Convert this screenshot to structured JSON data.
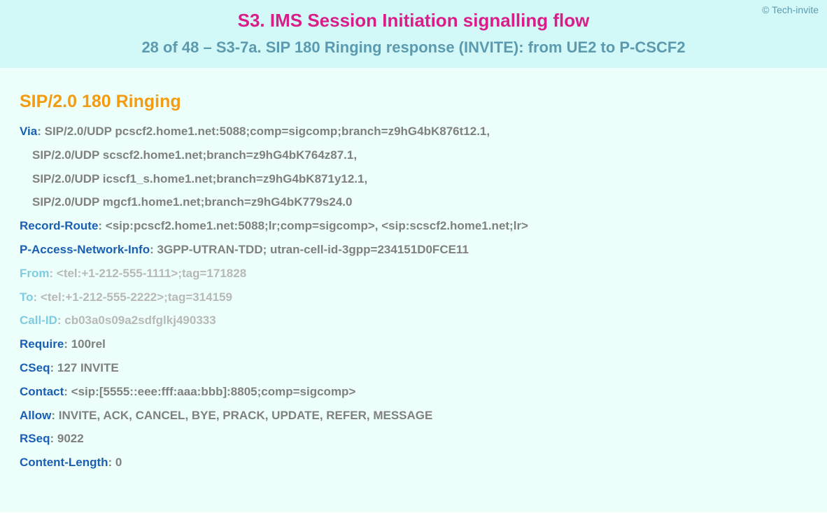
{
  "header": {
    "copyright": "© Tech-invite",
    "title": "S3. IMS Session Initiation signalling flow",
    "subtitle": "28 of 48 – S3-7a. SIP 180 Ringing response (INVITE): from UE2 to P-CSCF2"
  },
  "content": {
    "status_line": "SIP/2.0 180 Ringing",
    "headers": [
      {
        "name": "Via",
        "value": "SIP/2.0/UDP pcscf2.home1.net:5088;comp=sigcomp;branch=z9hG4bK876t12.1,",
        "faded": false,
        "continuations": [
          "SIP/2.0/UDP scscf2.home1.net;branch=z9hG4bK764z87.1,",
          "SIP/2.0/UDP icscf1_s.home1.net;branch=z9hG4bK871y12.1,",
          "SIP/2.0/UDP mgcf1.home1.net;branch=z9hG4bK779s24.0"
        ]
      },
      {
        "name": "Record-Route",
        "value": "<sip:pcscf2.home1.net:5088;lr;comp=sigcomp>, <sip:scscf2.home1.net;lr>",
        "faded": false
      },
      {
        "name": "P-Access-Network-Info",
        "value": "3GPP-UTRAN-TDD; utran-cell-id-3gpp=234151D0FCE11",
        "faded": false
      },
      {
        "name": "From",
        "value": "<tel:+1-212-555-1111>;tag=171828",
        "faded": true
      },
      {
        "name": "To",
        "value": "<tel:+1-212-555-2222>;tag=314159",
        "faded": true
      },
      {
        "name": "Call-ID",
        "value": "cb03a0s09a2sdfglkj490333",
        "faded": true
      },
      {
        "name": "Require",
        "value": "100rel",
        "faded": false
      },
      {
        "name": "CSeq",
        "value": "127 INVITE",
        "faded": false
      },
      {
        "name": "Contact",
        "value": "<sip:[5555::eee:fff:aaa:bbb]:8805;comp=sigcomp>",
        "faded": false
      },
      {
        "name": "Allow",
        "value": "INVITE, ACK, CANCEL, BYE, PRACK, UPDATE, REFER, MESSAGE",
        "faded": false
      },
      {
        "name": "RSeq",
        "value": "9022",
        "faded": false
      },
      {
        "name": "Content-Length",
        "value": "0",
        "faded": false
      }
    ]
  }
}
